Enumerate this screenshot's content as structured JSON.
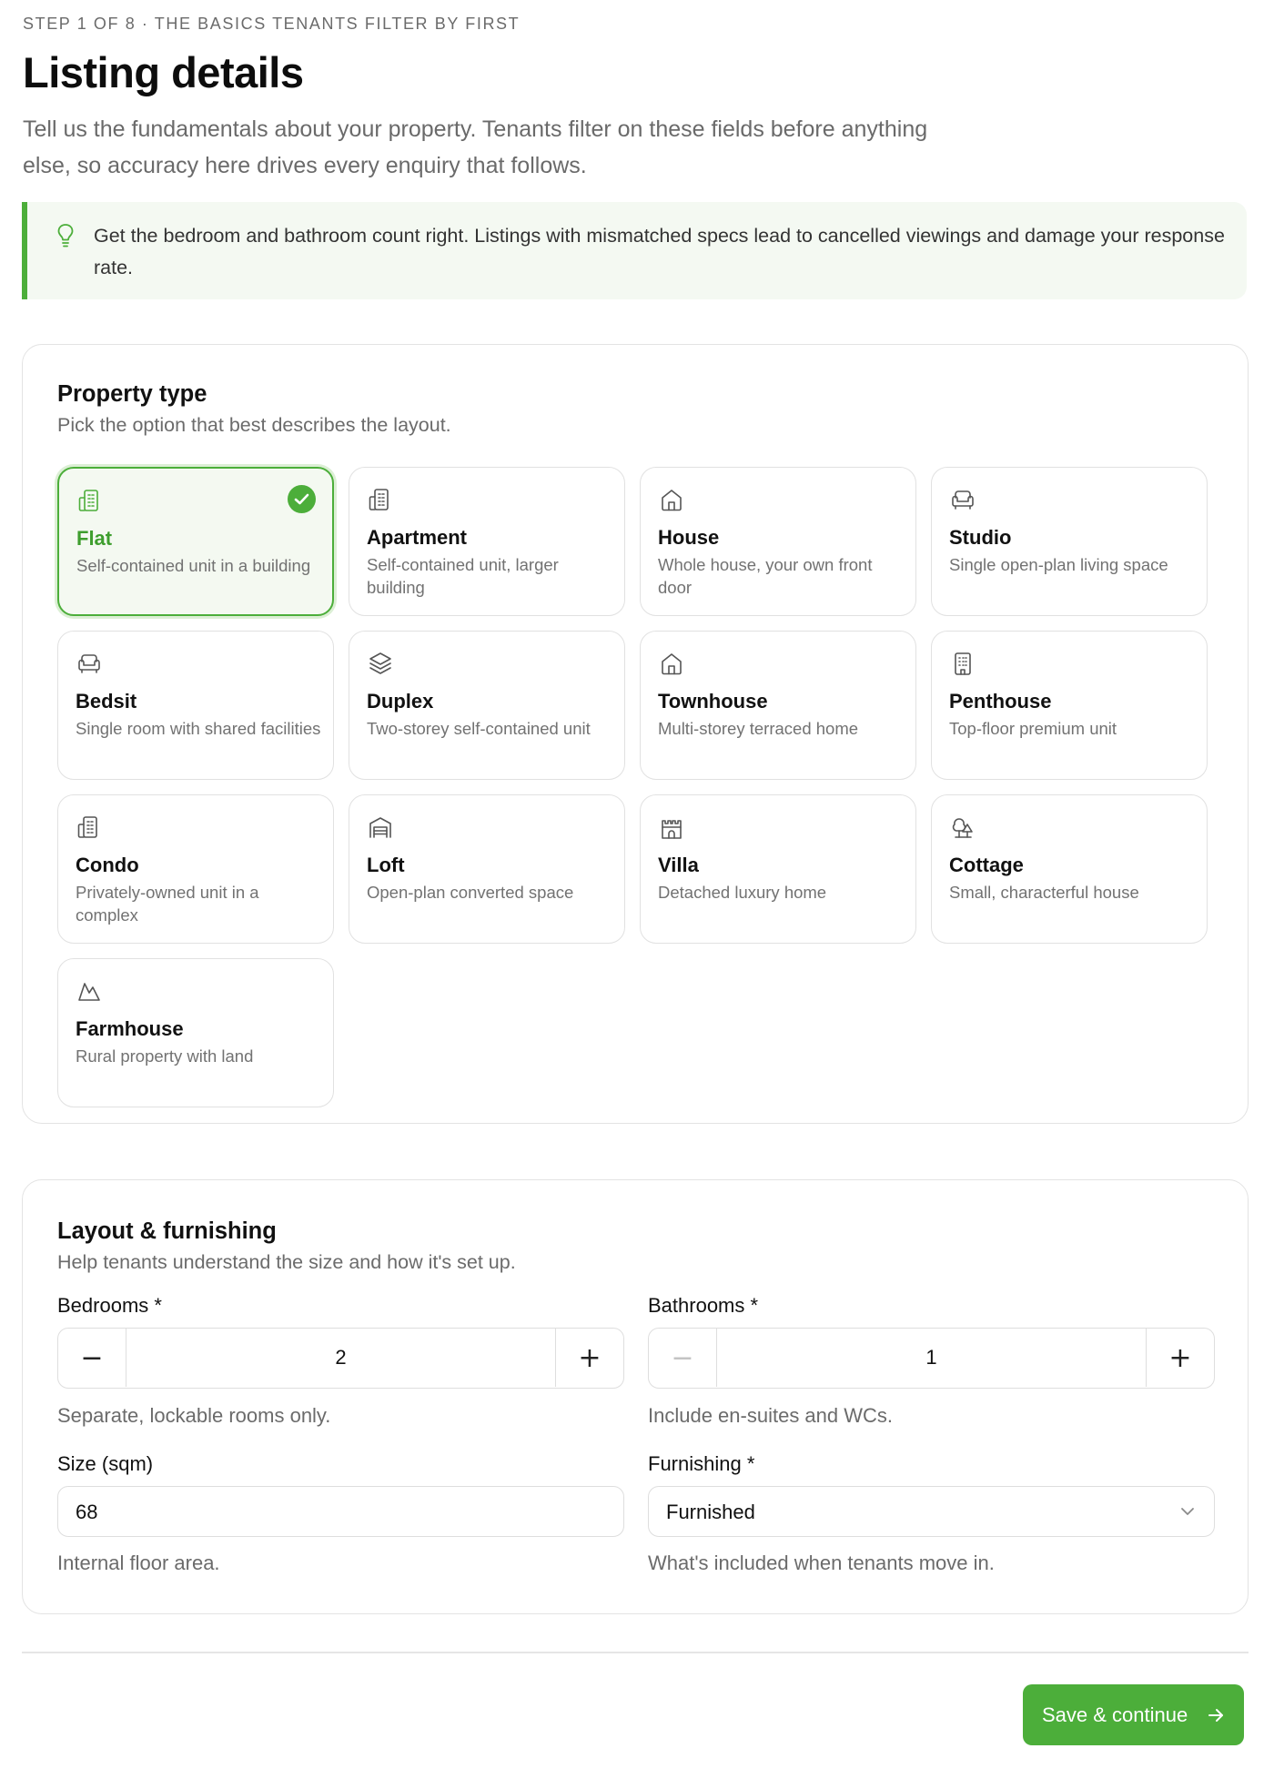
{
  "header": {
    "eyebrow": "STEP 1 OF 8 · THE BASICS TENANTS FILTER BY FIRST",
    "title": "Listing details",
    "description": "Tell us the fundamentals about your property. Tenants filter on these fields before anything else, so accuracy here drives every enquiry that follows."
  },
  "tip": {
    "icon": "lightbulb-icon",
    "text": "Get the bedroom and bathroom count right. Listings with mismatched specs lead to cancelled viewings and damage your response rate."
  },
  "property_type": {
    "title": "Property type",
    "subtitle": "Pick the option that best describes the layout.",
    "selected": "flat",
    "options": [
      {
        "id": "flat",
        "name": "Flat",
        "description": "Self-contained unit in a building",
        "icon": "building-icon"
      },
      {
        "id": "apartment",
        "name": "Apartment",
        "description": "Self-contained unit, larger building",
        "icon": "building-icon"
      },
      {
        "id": "house",
        "name": "House",
        "description": "Whole house, your own front door",
        "icon": "house-icon"
      },
      {
        "id": "studio",
        "name": "Studio",
        "description": "Single open-plan living space",
        "icon": "sofa-icon"
      },
      {
        "id": "bedsit",
        "name": "Bedsit",
        "description": "Single room with shared facilities",
        "icon": "sofa-icon"
      },
      {
        "id": "duplex",
        "name": "Duplex",
        "description": "Two-storey self-contained unit",
        "icon": "layers-icon"
      },
      {
        "id": "townhouse",
        "name": "Townhouse",
        "description": "Multi-storey terraced home",
        "icon": "house-icon"
      },
      {
        "id": "penthouse",
        "name": "Penthouse",
        "description": "Top-floor premium unit",
        "icon": "office-building-icon"
      },
      {
        "id": "condo",
        "name": "Condo",
        "description": "Privately-owned unit in a complex",
        "icon": "building-icon"
      },
      {
        "id": "loft",
        "name": "Loft",
        "description": "Open-plan converted space",
        "icon": "warehouse-icon"
      },
      {
        "id": "villa",
        "name": "Villa",
        "description": "Detached luxury home",
        "icon": "castle-icon"
      },
      {
        "id": "cottage",
        "name": "Cottage",
        "description": "Small, characterful house",
        "icon": "trees-icon"
      },
      {
        "id": "farmhouse",
        "name": "Farmhouse",
        "description": "Rural property with land",
        "icon": "mountain-icon"
      }
    ]
  },
  "layout": {
    "title": "Layout & furnishing",
    "subtitle": "Help tenants understand the size and how it's set up.",
    "bedrooms": {
      "label": "Bedrooms *",
      "value": "2",
      "minus": "−",
      "plus": "+",
      "help": "Separate, lockable rooms only."
    },
    "bathrooms": {
      "label": "Bathrooms *",
      "value": "1",
      "minus": "−",
      "plus": "+",
      "help": "Include en-suites and WCs."
    },
    "size": {
      "label": "Size (sqm)",
      "value": "68",
      "help": "Internal floor area."
    },
    "furnishing": {
      "label": "Furnishing *",
      "value": "Furnished",
      "help": "What's included when tenants move in."
    }
  },
  "footer": {
    "save_label": "Save & continue",
    "save_icon": "arrow-right-icon"
  },
  "colors": {
    "accent": "#4cae3a",
    "tip_background": "#f4f9f2"
  }
}
